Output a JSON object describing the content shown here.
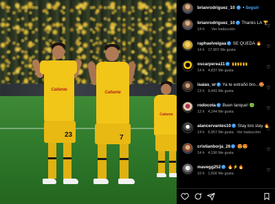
{
  "post": {
    "author": "brianrodriguez_10",
    "follow_label": "Seguir",
    "verified_badge": "✓"
  },
  "photo": {
    "players": [
      {
        "number": "23",
        "sponsor": "Caliente"
      },
      {
        "number": "7",
        "sponsor": "Caliente"
      },
      {
        "sponsor": "Caliente"
      }
    ]
  },
  "comments": [
    {
      "user": "brianrodriguez_10",
      "verified": true,
      "text": "Thanks LA 🏆",
      "time": "14 h",
      "likes": "",
      "extra": "Ver traducción",
      "avatar": "av1"
    },
    {
      "user": "raphaelveigaa",
      "verified": true,
      "text": "SE QUEDA 🔥",
      "time": "14 h",
      "likes": "17,907 Me gusta",
      "extra": "",
      "avatar": "av2"
    },
    {
      "user": "oscarperea11",
      "verified": true,
      "text": "🙌🙌🙌",
      "time": "14 h",
      "likes": "4,837 Me gusta",
      "extra": "",
      "avatar": "av3"
    },
    {
      "user": "isaias_vr",
      "verified": true,
      "text": "Ya te extrañó bro...🤩",
      "time": "13 h",
      "likes": "9,441 Me gusta",
      "extra": "",
      "avatar": "av4"
    },
    {
      "user": "rodocota",
      "verified": true,
      "text": "Buen tanque! 🟢",
      "time": "12 h",
      "likes": "4,244 Me gusta",
      "extra": "",
      "avatar": "av5"
    },
    {
      "user": "alancervantes10",
      "verified": true,
      "text": "Stay bro stay 🔥",
      "time": "14 h",
      "likes": "6,957 Me gusta",
      "extra": "Ver traducción",
      "avatar": "av6"
    },
    {
      "user": "cristianborja_26",
      "verified": true,
      "text": "😍😍",
      "time": "14 h",
      "likes": "4,190 Me gusta",
      "extra": "",
      "avatar": "av7"
    },
    {
      "user": "mavegg252",
      "verified": true,
      "text": "🔥⚡🔥",
      "time": "10 h",
      "likes": "1,600 Me gusta",
      "extra": "",
      "avatar": "av8"
    }
  ],
  "icons": {
    "like": "heart-icon",
    "comment": "comment-icon",
    "share": "share-icon",
    "save": "bookmark-icon"
  }
}
